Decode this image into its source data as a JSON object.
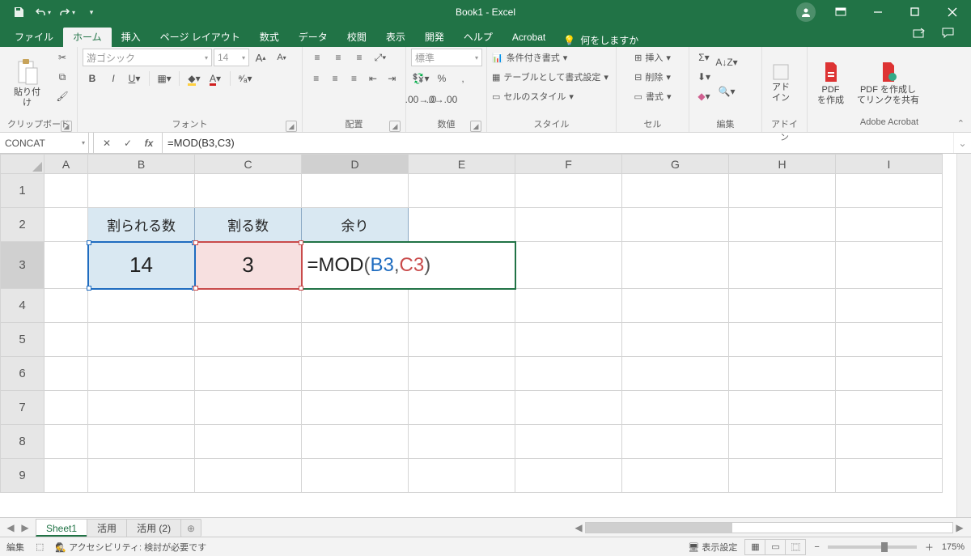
{
  "title": "Book1  -  Excel",
  "qat": {
    "save": "save",
    "undo": "undo",
    "redo": "redo"
  },
  "tabs": {
    "items": [
      {
        "label": "ファイル"
      },
      {
        "label": "ホーム",
        "active": true
      },
      {
        "label": "挿入"
      },
      {
        "label": "ページ レイアウト"
      },
      {
        "label": "数式"
      },
      {
        "label": "データ"
      },
      {
        "label": "校閲"
      },
      {
        "label": "表示"
      },
      {
        "label": "開発"
      },
      {
        "label": "ヘルプ"
      },
      {
        "label": "Acrobat"
      }
    ],
    "tell": "何をしますか"
  },
  "ribbon": {
    "clipboard": {
      "paste": "貼り付け",
      "label": "クリップボード"
    },
    "font": {
      "name": "游ゴシック",
      "size": "14",
      "label": "フォント"
    },
    "align": {
      "label": "配置"
    },
    "number": {
      "format": "標準",
      "label": "数値"
    },
    "styles": {
      "cond": "条件付き書式",
      "table": "テーブルとして書式設定",
      "cell": "セルのスタイル",
      "label": "スタイル"
    },
    "cells": {
      "insert": "挿入",
      "delete": "削除",
      "format": "書式",
      "label": "セル"
    },
    "editing": {
      "label": "編集"
    },
    "addin": {
      "btn": "アド\nイン",
      "label": "アドイン"
    },
    "acrobat": {
      "create": "PDF\nを作成",
      "share": "PDF を作成し\nてリンクを共有",
      "label": "Adobe Acrobat"
    }
  },
  "fbar": {
    "name": "CONCAT",
    "formula": "=MOD(B3,C3)"
  },
  "grid": {
    "cols": [
      "A",
      "B",
      "C",
      "D",
      "E",
      "F",
      "G",
      "H",
      "I"
    ],
    "rows": [
      "1",
      "2",
      "3",
      "4",
      "5",
      "6",
      "7",
      "8",
      "9"
    ],
    "selected": {
      "col": "D",
      "row": "3"
    },
    "headers": {
      "dividend": "割られる数",
      "divisor": "割る数",
      "remainder": "余り"
    },
    "values": {
      "b3": "14",
      "c3": "3"
    },
    "d3": {
      "eq": "=",
      "fn": "MOD",
      "open": "(",
      "a1": "B3",
      "comma": ",",
      "a2": "C3",
      "close": ")"
    }
  },
  "sheetTabs": {
    "items": [
      {
        "label": "Sheet1",
        "active": true
      },
      {
        "label": "活用"
      },
      {
        "label": "活用 (2)"
      }
    ],
    "add": "⊕"
  },
  "status": {
    "mode": "編集",
    "access": "アクセシビリティ: 検討が必要です",
    "display": "表示設定",
    "zoom": "175%"
  }
}
